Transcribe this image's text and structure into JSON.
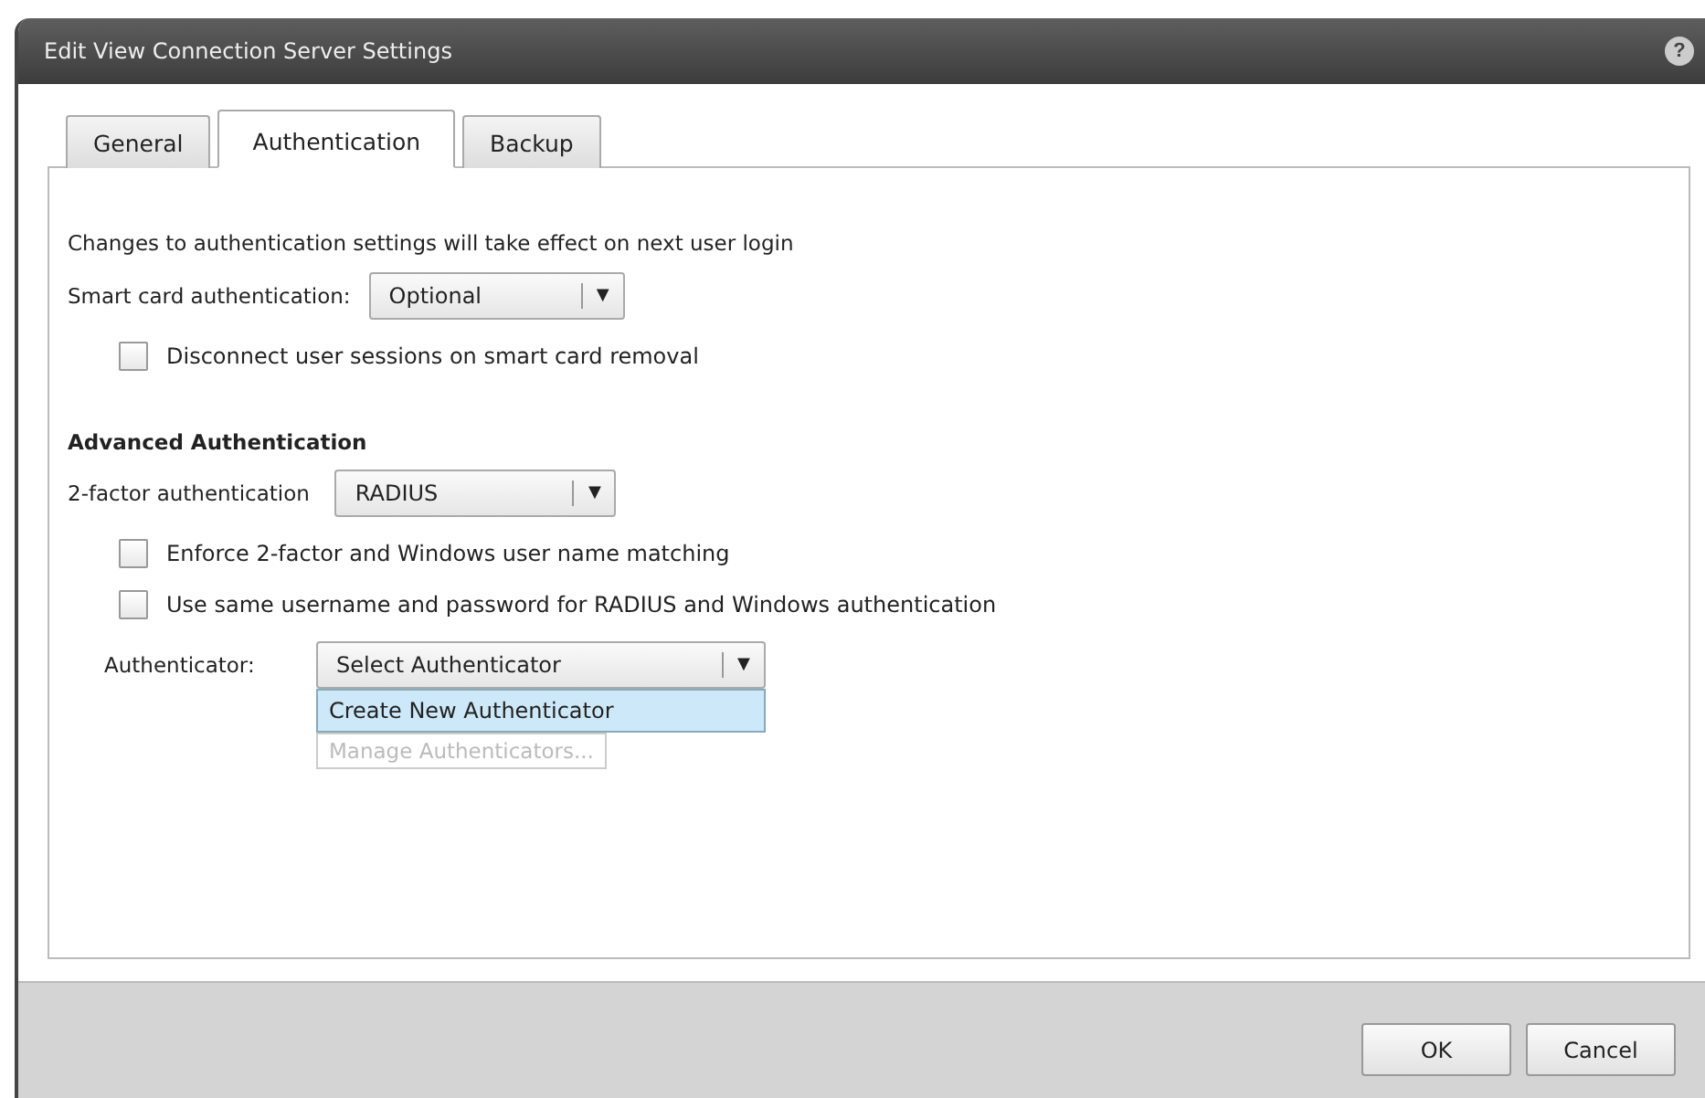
{
  "window": {
    "title": "Edit View Connection Server Settings",
    "help": "?"
  },
  "tabs": [
    {
      "label": "General",
      "selected": false
    },
    {
      "label": "Authentication",
      "selected": true
    },
    {
      "label": "Backup",
      "selected": false
    }
  ],
  "notice": "Changes to authentication settings will take effect on next user login",
  "smart_card": {
    "label": "Smart card authentication:",
    "value": "Optional",
    "caret": "▼"
  },
  "disconnect": {
    "label": "Disconnect user sessions on smart card removal",
    "checked": false
  },
  "advanced": {
    "heading": "Advanced Authentication",
    "two_factor": {
      "label": "2-factor authentication",
      "value": "RADIUS",
      "caret": "▼"
    },
    "options": [
      {
        "label": "Enforce 2-factor and Windows user name matching",
        "checked": false
      },
      {
        "label": "Use same username and password for RADIUS and Windows authentication",
        "checked": false
      }
    ],
    "authenticator": {
      "label": "Authenticator:",
      "value": "Select Authenticator",
      "caret": "▼",
      "menu": [
        {
          "label": "Create New Authenticator",
          "selected": true,
          "disabled": false
        },
        {
          "label": "Manage Authenticators...",
          "selected": false,
          "disabled": true
        }
      ]
    }
  },
  "buttons": [
    "OK",
    "Cancel"
  ]
}
